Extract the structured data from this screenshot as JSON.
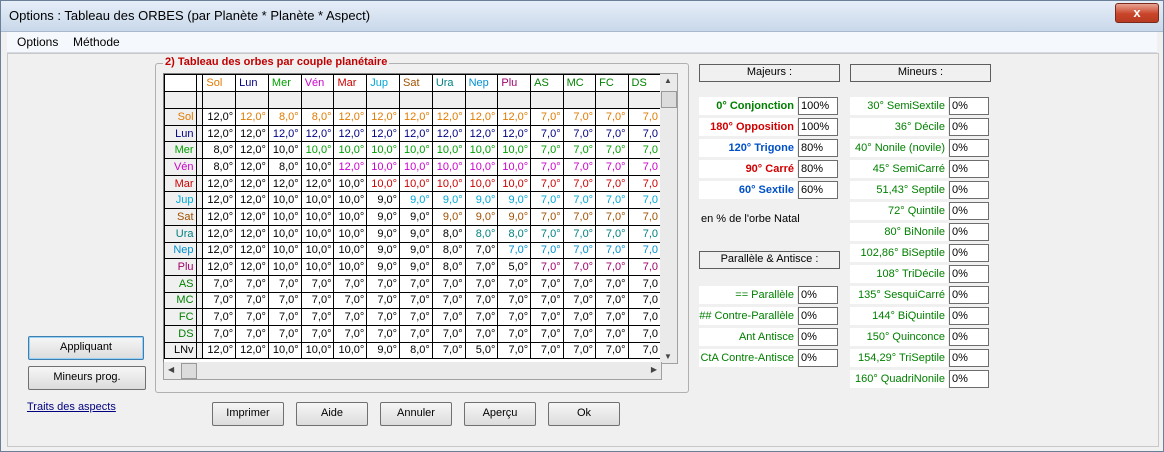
{
  "window": {
    "title": "Options : Tableau des ORBES (par Planète * Planète * Aspect)",
    "close": "x"
  },
  "menu": [
    "Options",
    "Méthode"
  ],
  "group_title": "2) Tableau des orbes par couple planétaire",
  "columns": [
    {
      "label": "Sol",
      "color": "#e07a00"
    },
    {
      "label": "Lun",
      "color": "#000080"
    },
    {
      "label": "Mer",
      "color": "#00a000"
    },
    {
      "label": "Vén",
      "color": "#cc00cc"
    },
    {
      "label": "Mar",
      "color": "#cc0000"
    },
    {
      "label": "Jup",
      "color": "#00a8d8"
    },
    {
      "label": "Sat",
      "color": "#a05000"
    },
    {
      "label": "Ura",
      "color": "#008080"
    },
    {
      "label": "Nep",
      "color": "#0090d0"
    },
    {
      "label": "Plu",
      "color": "#a0006a"
    },
    {
      "label": "AS",
      "color": "#008000"
    },
    {
      "label": "MC",
      "color": "#008000"
    },
    {
      "label": "FC",
      "color": "#008000"
    },
    {
      "label": "DS",
      "color": "#008000"
    }
  ],
  "rows": [
    {
      "label": "Sol",
      "color": "#e07a00",
      "values": [
        "12,0°",
        "12,0°",
        "8,0°",
        "8,0°",
        "12,0°",
        "12,0°",
        "12,0°",
        "12,0°",
        "12,0°",
        "12,0°",
        "7,0°",
        "7,0°",
        "7,0°",
        "7,0"
      ]
    },
    {
      "label": "Lun",
      "color": "#000080",
      "values": [
        "12,0°",
        "12,0°",
        "12,0°",
        "12,0°",
        "12,0°",
        "12,0°",
        "12,0°",
        "12,0°",
        "12,0°",
        "12,0°",
        "7,0°",
        "7,0°",
        "7,0°",
        "7,0"
      ]
    },
    {
      "label": "Mer",
      "color": "#00a000",
      "values": [
        "8,0°",
        "12,0°",
        "10,0°",
        "10,0°",
        "10,0°",
        "10,0°",
        "10,0°",
        "10,0°",
        "10,0°",
        "10,0°",
        "7,0°",
        "7,0°",
        "7,0°",
        "7,0"
      ]
    },
    {
      "label": "Vén",
      "color": "#cc00cc",
      "values": [
        "8,0°",
        "12,0°",
        "8,0°",
        "10,0°",
        "12,0°",
        "10,0°",
        "10,0°",
        "10,0°",
        "10,0°",
        "10,0°",
        "7,0°",
        "7,0°",
        "7,0°",
        "7,0"
      ]
    },
    {
      "label": "Mar",
      "color": "#cc0000",
      "values": [
        "12,0°",
        "12,0°",
        "12,0°",
        "12,0°",
        "10,0°",
        "10,0°",
        "10,0°",
        "10,0°",
        "10,0°",
        "10,0°",
        "7,0°",
        "7,0°",
        "7,0°",
        "7,0"
      ]
    },
    {
      "label": "Jup",
      "color": "#00a8d8",
      "values": [
        "12,0°",
        "12,0°",
        "10,0°",
        "10,0°",
        "10,0°",
        "9,0°",
        "9,0°",
        "9,0°",
        "9,0°",
        "9,0°",
        "7,0°",
        "7,0°",
        "7,0°",
        "7,0"
      ]
    },
    {
      "label": "Sat",
      "color": "#a05000",
      "values": [
        "12,0°",
        "12,0°",
        "10,0°",
        "10,0°",
        "10,0°",
        "9,0°",
        "9,0°",
        "9,0°",
        "9,0°",
        "9,0°",
        "7,0°",
        "7,0°",
        "7,0°",
        "7,0"
      ]
    },
    {
      "label": "Ura",
      "color": "#008080",
      "values": [
        "12,0°",
        "12,0°",
        "10,0°",
        "10,0°",
        "10,0°",
        "9,0°",
        "9,0°",
        "8,0°",
        "8,0°",
        "8,0°",
        "7,0°",
        "7,0°",
        "7,0°",
        "7,0"
      ]
    },
    {
      "label": "Nep",
      "color": "#0090d0",
      "values": [
        "12,0°",
        "12,0°",
        "10,0°",
        "10,0°",
        "10,0°",
        "9,0°",
        "9,0°",
        "8,0°",
        "7,0°",
        "7,0°",
        "7,0°",
        "7,0°",
        "7,0°",
        "7,0"
      ]
    },
    {
      "label": "Plu",
      "color": "#a0006a",
      "values": [
        "12,0°",
        "12,0°",
        "10,0°",
        "10,0°",
        "10,0°",
        "9,0°",
        "9,0°",
        "8,0°",
        "7,0°",
        "5,0°",
        "7,0°",
        "7,0°",
        "7,0°",
        "7,0"
      ]
    },
    {
      "label": "AS",
      "color": "#008000",
      "values": [
        "7,0°",
        "7,0°",
        "7,0°",
        "7,0°",
        "7,0°",
        "7,0°",
        "7,0°",
        "7,0°",
        "7,0°",
        "7,0°",
        "7,0°",
        "7,0°",
        "7,0°",
        "7,0"
      ]
    },
    {
      "label": "MC",
      "color": "#008000",
      "values": [
        "7,0°",
        "7,0°",
        "7,0°",
        "7,0°",
        "7,0°",
        "7,0°",
        "7,0°",
        "7,0°",
        "7,0°",
        "7,0°",
        "7,0°",
        "7,0°",
        "7,0°",
        "7,0"
      ]
    },
    {
      "label": "FC",
      "color": "#008000",
      "values": [
        "7,0°",
        "7,0°",
        "7,0°",
        "7,0°",
        "7,0°",
        "7,0°",
        "7,0°",
        "7,0°",
        "7,0°",
        "7,0°",
        "7,0°",
        "7,0°",
        "7,0°",
        "7,0"
      ]
    },
    {
      "label": "DS",
      "color": "#008000",
      "values": [
        "7,0°",
        "7,0°",
        "7,0°",
        "7,0°",
        "7,0°",
        "7,0°",
        "7,0°",
        "7,0°",
        "7,0°",
        "7,0°",
        "7,0°",
        "7,0°",
        "7,0°",
        "7,0"
      ]
    },
    {
      "label": "LNv",
      "color": "#000000",
      "values": [
        "12,0°",
        "12,0°",
        "10,0°",
        "10,0°",
        "10,0°",
        "9,0°",
        "8,0°",
        "7,0°",
        "5,0°",
        "7,0°",
        "7,0°",
        "7,0°",
        "7,0°",
        "7,0"
      ]
    }
  ],
  "buttons": {
    "appliquant": "Appliquant",
    "mineurs_prog": "Mineurs prog.",
    "traits": "Traits des aspects",
    "imprimer": "Imprimer",
    "aide": "Aide",
    "annuler": "Annuler",
    "apercu": "Aperçu",
    "ok": "Ok"
  },
  "majeurs": {
    "header": "Majeurs :",
    "items": [
      {
        "label": "0° Conjonction",
        "value": "100%",
        "color": "#008000"
      },
      {
        "label": "180° Opposition",
        "value": "100%",
        "color": "#d00000"
      },
      {
        "label": "120° Trigone",
        "value": "80%",
        "color": "#0050c8"
      },
      {
        "label": "90° Carré",
        "value": "80%",
        "color": "#d00000"
      },
      {
        "label": "60° Sextile",
        "value": "60%",
        "color": "#0050c8"
      }
    ],
    "note": "en % de l'orbe Natal"
  },
  "parallele": {
    "header": "Parallèle & Antisce :",
    "items": [
      {
        "label": "== Parallèle",
        "value": "0%"
      },
      {
        "label": "## Contre-Parallèle",
        "value": "0%"
      },
      {
        "label": "Ant Antisce",
        "value": "0%"
      },
      {
        "label": "CtA Contre-Antisce",
        "value": "0%"
      }
    ],
    "color": "#008000"
  },
  "mineurs": {
    "header": "Mineurs :",
    "items": [
      {
        "label": "30° SemiSextile",
        "value": "0%"
      },
      {
        "label": "36° Décile",
        "value": "0%"
      },
      {
        "label": "40° Nonile (novile)",
        "value": "0%"
      },
      {
        "label": "45° SemiCarré",
        "value": "0%"
      },
      {
        "label": "51,43° Septile",
        "value": "0%"
      },
      {
        "label": "72° Quintile",
        "value": "0%"
      },
      {
        "label": "80° BiNonile",
        "value": "0%"
      },
      {
        "label": "102,86° BiSeptile",
        "value": "0%"
      },
      {
        "label": "108° TriDécile",
        "value": "0%"
      },
      {
        "label": "135° SesquiCarré",
        "value": "0%"
      },
      {
        "label": "144° BiQuintile",
        "value": "0%"
      },
      {
        "label": "150° Quinconce",
        "value": "0%"
      },
      {
        "label": "154,29° TriSeptile",
        "value": "0%"
      },
      {
        "label": "160° QuadriNonile",
        "value": "0%"
      }
    ],
    "color": "#008000"
  }
}
